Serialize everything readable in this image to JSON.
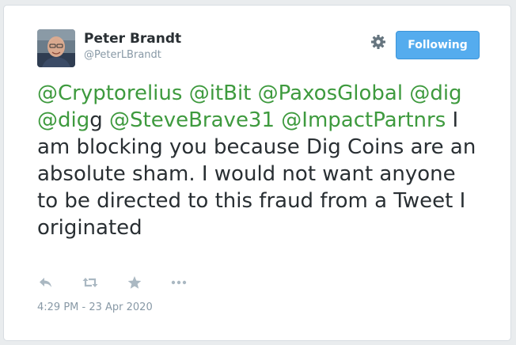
{
  "tweet": {
    "author_name": "Peter Brandt",
    "author_handle": "@PeterLBrandt",
    "follow_label": "Following",
    "text_parts": {
      "m1": "@Cryptorelius",
      "m2": "@itBit",
      "m3": "@PaxosGlobal",
      "m4": "@dig",
      "m5": "@dig",
      "m5_suffix": "g",
      "m6": "@SteveBrave31",
      "m7": "@ImpactPartnrs",
      "body": " I am blocking you because Dig Coins are an absolute sham. I would not want anyone to be directed to this fraud from a Tweet I originated"
    },
    "timestamp": "4:29 PM - 23 Apr 2020",
    "actions": [
      "reply-icon",
      "retweet-icon",
      "favorite-icon",
      "more-icon"
    ]
  },
  "colors": {
    "mention": "#3e9a3e",
    "follow_button": "#55acee",
    "text": "#292f33",
    "muted": "#8899a6"
  }
}
